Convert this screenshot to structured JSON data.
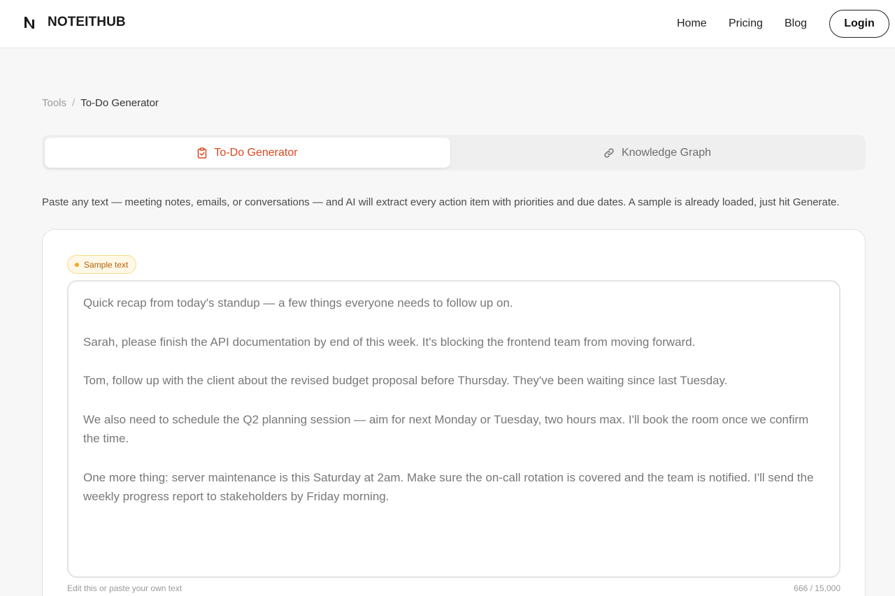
{
  "brand": {
    "name": "NOTEITHUB"
  },
  "nav": {
    "home": "Home",
    "pricing": "Pricing",
    "blog": "Blog",
    "login": "Login"
  },
  "breadcrumb": {
    "parent": "Tools",
    "separator": "/",
    "current": "To-Do Generator"
  },
  "tabs": [
    {
      "label": "To-Do Generator",
      "icon": "clipboard-check-icon",
      "active": true
    },
    {
      "label": "Knowledge Graph",
      "icon": "link-icon",
      "active": false
    }
  ],
  "description": "Paste any text — meeting notes, emails, or conversations — and AI will extract every action item with priorities and due dates. A sample is already loaded, just hit Generate.",
  "input": {
    "badge": "Sample text",
    "paragraphs": [
      "Quick recap from today's standup — a few things everyone needs to follow up on.",
      "Sarah, please finish the API documentation by end of this week. It's blocking the frontend team from moving forward.",
      "Tom, follow up with the client about the revised budget proposal before Thursday. They've been waiting since last Tuesday.",
      "We also need to schedule the Q2 planning session — aim for next Monday or Tuesday, two hours max. I'll book the room once we confirm the time.",
      "One more thing: server maintenance is this Saturday at 2am. Make sure the on-call rotation is covered and the team is notified. I'll send the weekly progress report to stakeholders by Friday morning."
    ],
    "hint": "Edit this or paste your own text",
    "char_count": "666 / 15,000"
  },
  "colors": {
    "accent": "#d9471f",
    "badge_bg": "#fff8e6",
    "badge_text": "#b3620a",
    "badge_dot": "#f2a81d"
  }
}
